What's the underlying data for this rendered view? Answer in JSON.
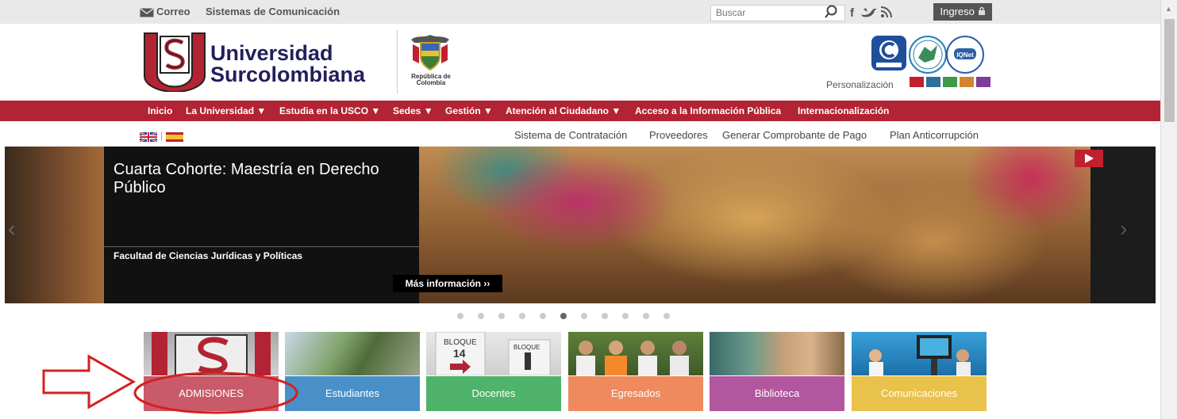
{
  "topbar": {
    "mail_label": "Correo",
    "systems_label": "Sistemas de Comunicación",
    "search_placeholder": "Buscar",
    "login_label": "Ingreso",
    "social_icons": [
      "facebook-icon",
      "twitter-icon",
      "rss-icon"
    ]
  },
  "header": {
    "university_line1": "Universidad",
    "university_line2": "Surcolombiana",
    "republic_line1": "República de",
    "republic_line2": "Colombia",
    "personalize_label": "Personalización",
    "swatch_colors": [
      "#c0202f",
      "#2f6f9c",
      "#3d9a4b",
      "#d5832f",
      "#7c3c97"
    ]
  },
  "nav": {
    "items": [
      {
        "label": "Inicio",
        "has_dropdown": false
      },
      {
        "label": "La Universidad ▼",
        "has_dropdown": true
      },
      {
        "label": "Estudia en la USCO ▼",
        "has_dropdown": true
      },
      {
        "label": "Sedes ▼",
        "has_dropdown": true
      },
      {
        "label": "Gestión ▼",
        "has_dropdown": true
      },
      {
        "label": "Atención al Ciudadano ▼",
        "has_dropdown": true
      },
      {
        "label": "Acceso a la Información Pública",
        "has_dropdown": false
      },
      {
        "label": "Internacionalización",
        "has_dropdown": false
      }
    ]
  },
  "subnav": {
    "links": [
      "Sistema de Contratación",
      "Proveedores",
      "Generar Comprobante de Pago",
      "Plan Anticorrupción"
    ]
  },
  "slider": {
    "title": "Cuarta Cohorte: Maestría en Derecho Público",
    "faculty": "Facultad de Ciencias Jurídicas y Políticas",
    "more_label": "Más información ››",
    "dot_count": 11,
    "active_dot": 6
  },
  "tiles": [
    {
      "label": "ADMISIONES",
      "color": "#c95a6a"
    },
    {
      "label": "Estudiantes",
      "color": "#4a90c8"
    },
    {
      "label": "Docentes",
      "color": "#4fb36b"
    },
    {
      "label": "Egresados",
      "color": "#ee8a5e"
    },
    {
      "label": "Biblioteca",
      "color": "#b2569f"
    },
    {
      "label": "Comunicaciones",
      "color": "#e9c24b"
    }
  ],
  "colors": {
    "brand_red": "#b22433",
    "annotation_red": "#d42020"
  }
}
